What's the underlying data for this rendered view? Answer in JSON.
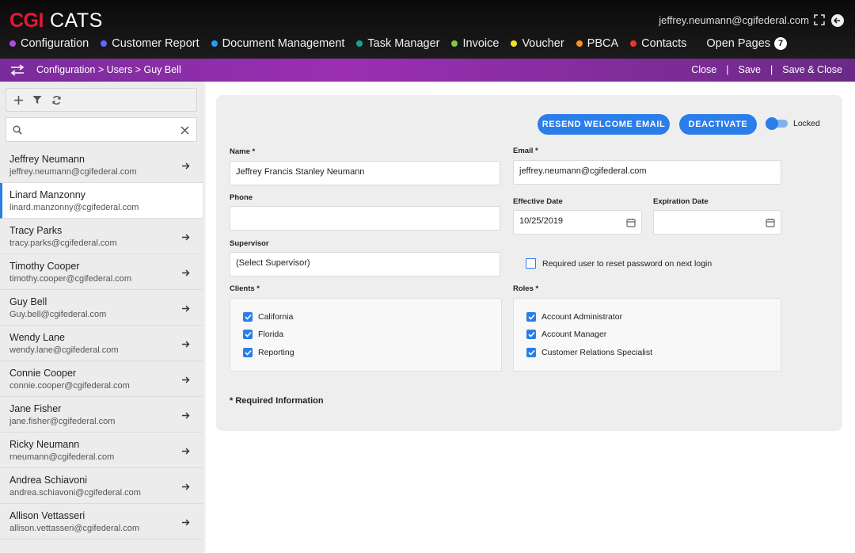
{
  "header": {
    "brand_cgi": "CGI",
    "brand_app": "CATS",
    "user_email": "jeffrey.neumann@cgifederal.com"
  },
  "nav": {
    "items": [
      {
        "label": "Configuration",
        "color": "#b04be0"
      },
      {
        "label": "Customer Report",
        "color": "#5c6bff"
      },
      {
        "label": "Document Management",
        "color": "#1e9fff"
      },
      {
        "label": "Task Manager",
        "color": "#15a58b"
      },
      {
        "label": "Invoice",
        "color": "#7ac943"
      },
      {
        "label": "Voucher",
        "color": "#f2e12b"
      },
      {
        "label": "PBCA",
        "color": "#f7931e"
      },
      {
        "label": "Contacts",
        "color": "#e8382f"
      }
    ],
    "open_pages_label": "Open Pages",
    "open_pages_count": "7"
  },
  "breadcrumb": {
    "text": "Configuration > Users > Guy Bell"
  },
  "actions": {
    "close": "Close",
    "sep1": "|",
    "save": "Save",
    "sep2": "|",
    "save_close": "Save & Close"
  },
  "sidebar": {
    "search_value": "",
    "users": [
      {
        "name": "Jeffrey Neumann",
        "email": "jeffrey.neumann@cgifederal.com"
      },
      {
        "name": "Linard Manzonny",
        "email": "linard.manzonny@cgifederal.com"
      },
      {
        "name": "Tracy Parks",
        "email": "tracy.parks@cgifederal.com"
      },
      {
        "name": "Timothy Cooper",
        "email": "timothy.cooper@cgifederal.com"
      },
      {
        "name": "Guy Bell",
        "email": "Guy.bell@cgifederal.com"
      },
      {
        "name": "Wendy Lane",
        "email": "wendy.lane@cgifederal.com"
      },
      {
        "name": "Connie Cooper",
        "email": "connie.cooper@cgifederal.com"
      },
      {
        "name": "Jane Fisher",
        "email": "jane.fisher@cgifederal.com"
      },
      {
        "name": "Ricky Neumann",
        "email": "rneumann@cgifederal.com"
      },
      {
        "name": "Andrea Schiavoni",
        "email": "andrea.schiavoni@cgifederal.com"
      },
      {
        "name": "Allison Vettasseri",
        "email": "allison.vettasseri@cgifederal.com"
      }
    ]
  },
  "form": {
    "resend_label": "RESEND WELCOME EMAIL",
    "deactivate_label": "DEACTIVATE",
    "locked_label": "Locked",
    "name_label": "Name *",
    "name_value": "Jeffrey Francis Stanley Neumann",
    "email_label": "Email *",
    "email_value": "jeffrey.neumann@cgifederal.com",
    "phone_label": "Phone",
    "phone_value": "",
    "effective_label": "Effective Date",
    "effective_value": "10/25/2019",
    "expiration_label": "Expiration Date",
    "expiration_value": "",
    "supervisor_label": "Supervisor",
    "supervisor_value": "(Select Supervisor)",
    "reset_label": "Required user to reset password on next login",
    "clients_label": "Clients *",
    "clients": [
      "California",
      "Florida",
      "Reporting"
    ],
    "roles_label": "Roles *",
    "roles": [
      "Account Administrator",
      "Account Manager",
      "Customer Relations Specialist"
    ],
    "required_info": "*  Required Information"
  },
  "colors": {
    "accent": "#2b7de9",
    "purple_bar": "#8e2fa8",
    "brand_red": "#e31937"
  }
}
